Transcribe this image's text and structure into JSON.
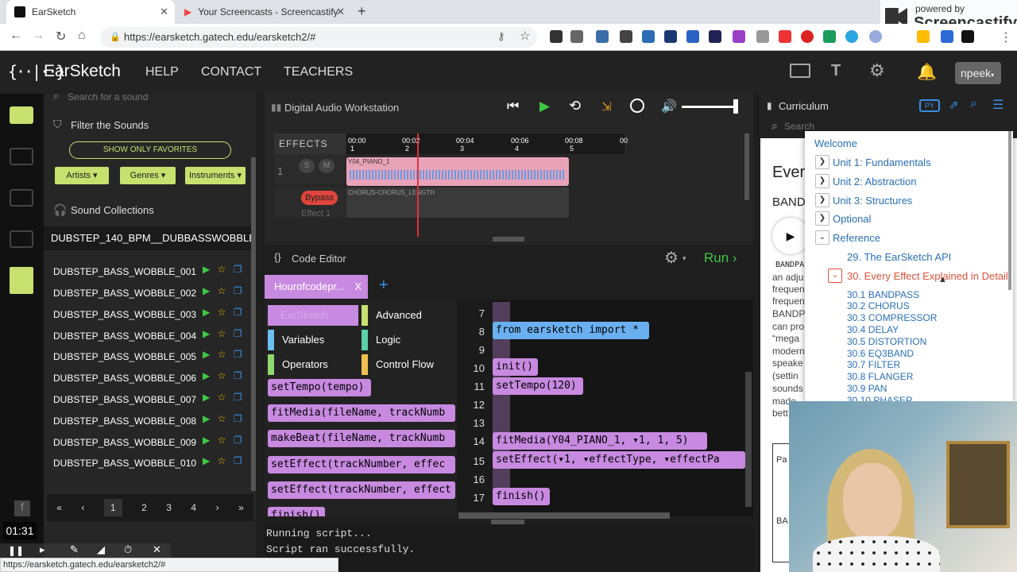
{
  "browser": {
    "tab1": "EarSketch",
    "tab2": "Your Screencasts - Screencastify",
    "url": "https://earsketch.gatech.edu/earsketch2/#",
    "status_url": "https://earsketch.gatech.edu/earsketch2/#",
    "screencastify_brand": "powered by",
    "screencastify_name": "Screencastify"
  },
  "app": {
    "logo_text": "EarSketch",
    "logo_mark": "{··|··}",
    "nav": [
      "HELP",
      "CONTACT",
      "TEACHERS"
    ],
    "user": "npeek"
  },
  "sounds": {
    "search_placeholder": "Search for a sound",
    "filter_title": "Filter the Sounds",
    "show_favorites": "SHOW ONLY FAVORITES",
    "filters": [
      "Artists",
      "Genres",
      "Instruments"
    ],
    "collections_title": "Sound Collections",
    "folder": "DUBSTEP_140_BPM__DUBBASSWOBBLE",
    "items": [
      "DUBSTEP_BASS_WOBBLE_001",
      "DUBSTEP_BASS_WOBBLE_002",
      "DUBSTEP_BASS_WOBBLE_003",
      "DUBSTEP_BASS_WOBBLE_004",
      "DUBSTEP_BASS_WOBBLE_005",
      "DUBSTEP_BASS_WOBBLE_006",
      "DUBSTEP_BASS_WOBBLE_007",
      "DUBSTEP_BASS_WOBBLE_008",
      "DUBSTEP_BASS_WOBBLE_009",
      "DUBSTEP_BASS_WOBBLE_010"
    ],
    "pages": [
      "«",
      "‹",
      "1",
      "2",
      "3",
      "4",
      "›",
      "»"
    ]
  },
  "daw": {
    "title": "Digital Audio Workstation",
    "effects_label": "EFFECTS",
    "times": [
      "00:00",
      "00:02",
      "00:04",
      "00:06",
      "00:08",
      "00"
    ],
    "measures": [
      "1",
      "2",
      "3",
      "4",
      "5"
    ],
    "track_number": "1",
    "solo": "S",
    "mute": "M",
    "clip_name": "Y04_PIANO_1",
    "bypass": "Bypass",
    "effect_label": "Effect 1",
    "effect_clip": "CHORUS-CHORUS_LENGTH"
  },
  "editor": {
    "title": "Code Editor",
    "run": "Run",
    "file_tab": "Hourofcodepr...",
    "file_close": "X",
    "categories": [
      "EarSketch",
      "Advanced",
      "Variables",
      "Logic",
      "Operators",
      "Control Flow"
    ],
    "palette": [
      "setTempo(tempo)",
      "fitMedia(fileName, trackNumb",
      "makeBeat(fileName, trackNumb",
      "setEffect(trackNumber, effec",
      "setEffect(trackNumber, effect",
      "finish()"
    ],
    "line_numbers": [
      "7",
      "8",
      "9",
      "10",
      "11",
      "12",
      "13",
      "14",
      "15",
      "16",
      "17"
    ],
    "code": {
      "l8": "from earsketch import *",
      "l10": "init()",
      "l11": "setTempo(120)",
      "l14": "fitMedia(Y04_PIANO_1, ▾1, 1, 5)",
      "l15": "setEffect(▾1, ▾effectType, ▾effectPa",
      "l17": "finish()"
    }
  },
  "console": {
    "lines": [
      "Running script...",
      "Script ran successfully."
    ]
  },
  "curriculum": {
    "title": "Curriculum",
    "lang": "PY",
    "search_placeholder": "Search",
    "heading_partial": "Ever",
    "sub_partial": "BAND",
    "code_partial": "BANDPA",
    "body_partial": [
      "an adju",
      "frequen",
      "frequen",
      "BANDP",
      "can pro",
      "“mega",
      "modern",
      "speake",
      "(settin",
      "sounds",
      "made",
      "bett"
    ],
    "table_partial": [
      "Pa",
      "BA"
    ],
    "dropdown": {
      "top": [
        "Welcome",
        "Unit 1: Fundamentals",
        "Unit 2: Abstraction",
        "Unit 3: Structures",
        "Optional",
        "Reference"
      ],
      "ref_items": [
        "29. The EarSketch API",
        "30. Every Effect Explained in Detail"
      ],
      "effects": [
        "30.1 BANDPASS",
        "30.2 CHORUS",
        "30.3 COMPRESSOR",
        "30.4 DELAY",
        "30.5 DISTORTION",
        "30.6 EQ3BAND",
        "30.7 FILTER",
        "30.8 FLANGER",
        "30.9 PAN",
        "30.10 PHASER"
      ]
    }
  },
  "recorder": {
    "time": "01:31"
  },
  "colors": {
    "accent_green": "#3ec846",
    "block_purple": "#c78ae0",
    "clip_pink": "#e8a3b8",
    "link_blue": "#2a6fb8",
    "active_red": "#e0533c"
  }
}
